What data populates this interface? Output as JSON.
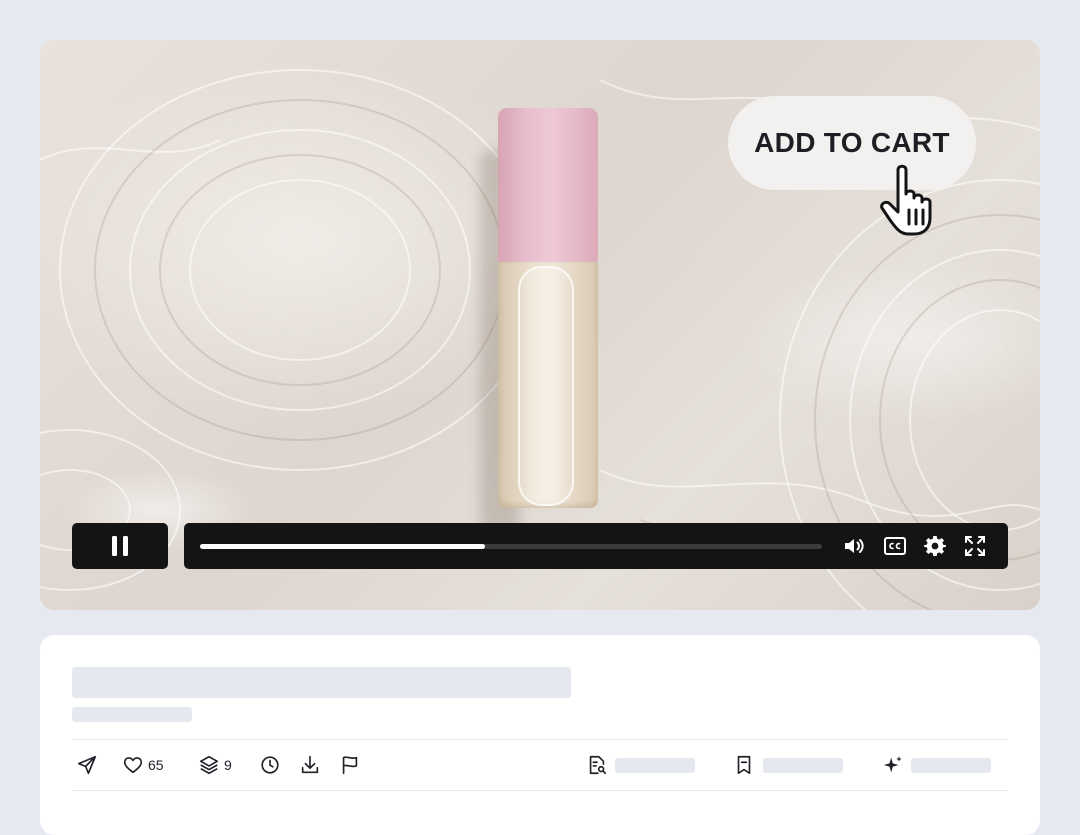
{
  "video": {
    "cta_label": "ADD TO CART",
    "progress_fraction": 0.458,
    "state": "playing",
    "controls": {
      "play_state_icon": "pause-icon",
      "volume_icon": "volume-icon",
      "captions_icon": "closed-captions-icon",
      "settings_icon": "gear-icon",
      "fullscreen_icon": "fullscreen-icon"
    }
  },
  "actions": {
    "likes": "65",
    "layers": "9"
  },
  "colors": {
    "page_bg": "#e6e9f0",
    "control_bar": "#141414",
    "cap_pink": "#e8bfcd",
    "skeleton": "#e5e8ef"
  }
}
